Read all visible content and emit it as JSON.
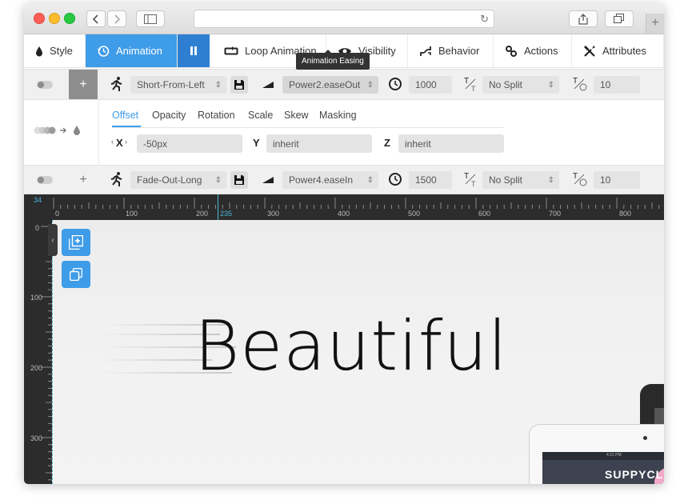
{
  "toolbar": {
    "back_icon": "chevron-left",
    "forward_icon": "chevron-right",
    "sidebar_icon": "sidebar",
    "reload_icon": "reload",
    "share_icon": "share",
    "tabs_icon": "tabs",
    "new_tab": "+"
  },
  "tabs": [
    {
      "label": "Style",
      "icon": "drop-icon"
    },
    {
      "label": "Animation",
      "icon": "history-icon",
      "active": true
    },
    {
      "label": "Loop Animation",
      "icon": "loop-icon"
    },
    {
      "label": "Visibility",
      "icon": "eye-icon"
    },
    {
      "label": "Behavior",
      "icon": "behavior-icon"
    },
    {
      "label": "Actions",
      "icon": "link-icon"
    },
    {
      "label": "Attributes",
      "icon": "tools-icon"
    }
  ],
  "tooltip": "Animation Easing",
  "in_row": {
    "add": "+",
    "transition": "Short-From-Left",
    "easing": "Power2.easeOut",
    "duration": "1000",
    "split": "No Split",
    "split_delay": "10"
  },
  "detail": {
    "tabs": [
      "Offset",
      "Opacity",
      "Rotation",
      "Scale",
      "Skew",
      "Masking"
    ],
    "active_tab": "Offset",
    "x_label": "X",
    "x_value": "-50px",
    "y_label": "Y",
    "y_value": "inherit",
    "z_label": "Z",
    "z_value": "inherit"
  },
  "out_row": {
    "add": "+",
    "transition": "Fade-Out-Long",
    "easing": "Power4.easeIn",
    "duration": "1500",
    "split": "No Split",
    "split_delay": "10"
  },
  "ruler": {
    "corner_value": "34",
    "marker_value": "235",
    "top_labels": [
      "0",
      "100",
      "200",
      "300",
      "400",
      "500",
      "600",
      "700",
      "800"
    ],
    "left_labels": [
      "0",
      "100",
      "200",
      "300"
    ]
  },
  "canvas": {
    "headline": "Beautiful",
    "device_brand": "SUPPYCLIC",
    "status_time": "4:21 PM"
  },
  "colors": {
    "accent": "#3f9ce8",
    "accent_dark": "#2e7fd1",
    "ruler_bg": "#2c2c2c",
    "guide": "#48b8d8"
  }
}
